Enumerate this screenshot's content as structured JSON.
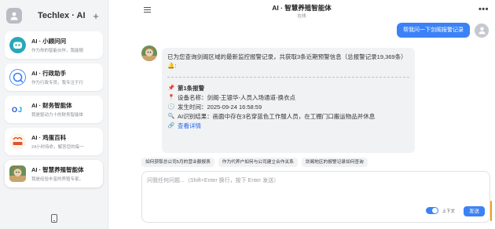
{
  "sidebar": {
    "title": "Techlex · AI",
    "new_chat": "+",
    "agents": [
      {
        "name": "AI · 小顾问问",
        "desc": "作为你的智能伙伴，我能随"
      },
      {
        "name": "AI · 行政助手",
        "desc": "作为行政专员，我专注于行"
      },
      {
        "name": "AI · 财务智能体",
        "desc": "我是驱动力十的财务智能体"
      },
      {
        "name": "AI · 鸡蛋百科",
        "desc": "24小时待命，解答您的每一"
      },
      {
        "name": "AI · 智慧养殖智能体",
        "desc": "我是经验丰富的养殖专家，"
      }
    ]
  },
  "header": {
    "title": "AI · 智慧养殖智能体",
    "status": "在线",
    "more": "•••"
  },
  "chat": {
    "user_message": "帮我问一下剑阁报警记录",
    "bot": {
      "intro": "已为您查询剑阁区域的最新监控报警记录，共获取3条近期预警信息（总报警记录19,369条）",
      "bell": "🔔:",
      "alarm_title": "第1条报警",
      "device": "设备名称：剑阁-王银华-人员入场通道-换衣点",
      "time": "发生时间：2025-09-24 16:58:59",
      "result": "AI识别结果：画面中存在3名穿蓝色工作服人员，在工棚门口搬运物品并休息",
      "details": "查看详情"
    }
  },
  "suggestions": [
    "如何获取总公司5月的营业额报表",
    "作为代养户如何与公司建立合作关系",
    "剑阁地区的报警记录如何查询"
  ],
  "composer": {
    "placeholder": "问我任何问题...（Shift+Enter 换行，按下 Enter 发送）",
    "context_label": "上下文",
    "send_label": "发送"
  },
  "colors": {
    "accent": "#3b82f6",
    "link": "#2563eb"
  }
}
